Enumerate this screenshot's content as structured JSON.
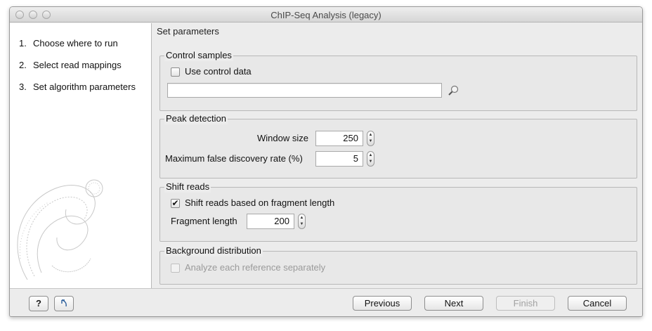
{
  "window": {
    "title": "ChIP-Seq Analysis (legacy)"
  },
  "steps": [
    {
      "num": "1.",
      "label": "Choose where to run"
    },
    {
      "num": "2.",
      "label": "Select read mappings"
    },
    {
      "num": "3.",
      "label": "Set algorithm parameters"
    }
  ],
  "content": {
    "title": "Set parameters",
    "control_samples": {
      "legend": "Control samples",
      "use_control_label": "Use control data",
      "use_control_checked": false,
      "path_value": ""
    },
    "peak_detection": {
      "legend": "Peak detection",
      "window_size_label": "Window size",
      "window_size_value": "250",
      "fdr_label": "Maximum false discovery rate (%)",
      "fdr_value": "5"
    },
    "shift_reads": {
      "legend": "Shift reads",
      "shift_label": "Shift reads based on fragment length",
      "shift_checked": true,
      "fragment_label": "Fragment length",
      "fragment_value": "200"
    },
    "background": {
      "legend": "Background distribution",
      "analyze_label": "Analyze each reference separately",
      "analyze_checked": false,
      "analyze_enabled": false
    }
  },
  "footer": {
    "help_label": "?",
    "help_icon": "question-mark",
    "reset_icon": "reset-arrow-icon",
    "previous_label": "Previous",
    "next_label": "Next",
    "finish_label": "Finish",
    "cancel_label": "Cancel"
  },
  "icons": {
    "browse": "browse-magnifier-icon",
    "checkmark": "✔",
    "spinner_up": "▲",
    "spinner_down": "▼"
  }
}
